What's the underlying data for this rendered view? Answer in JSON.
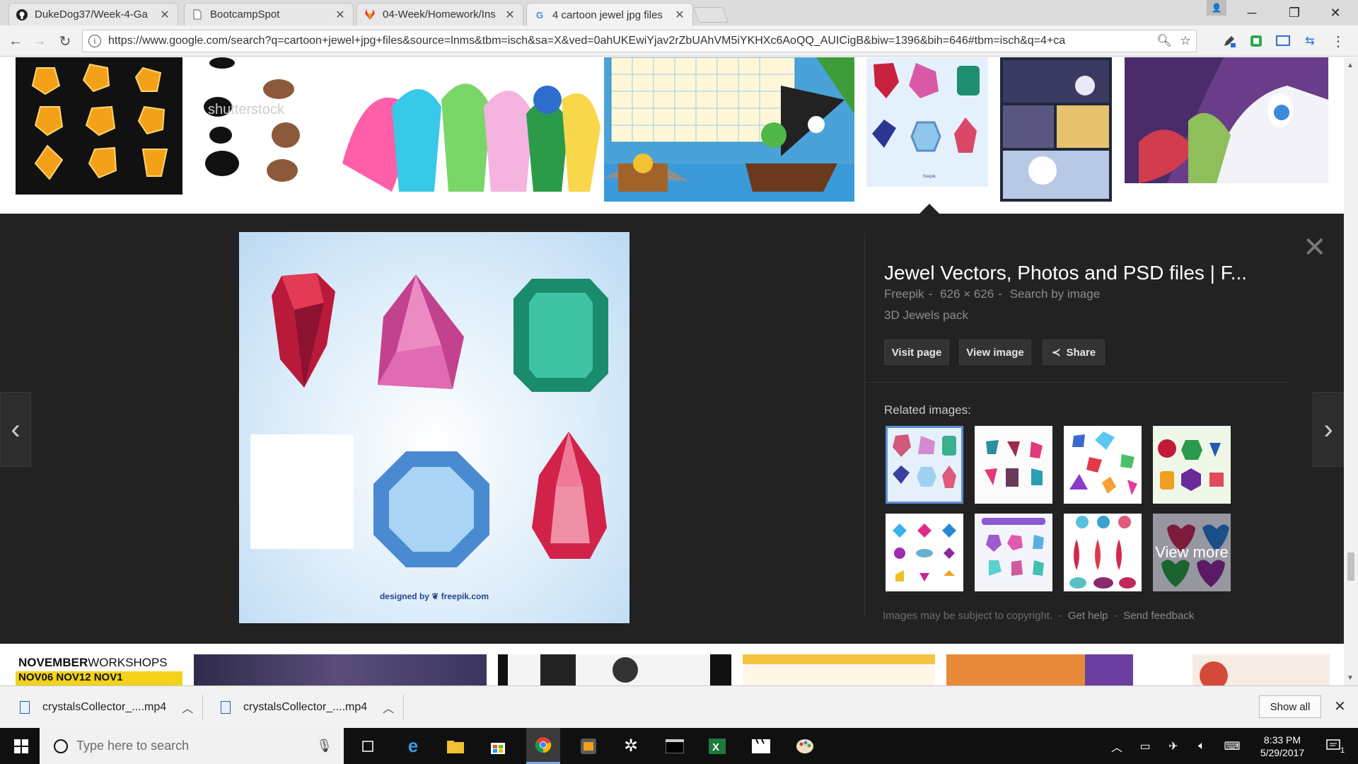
{
  "browser": {
    "tabs": [
      {
        "title": "DukeDog37/Week-4-Ga",
        "icon": "github-icon"
      },
      {
        "title": "BootcampSpot",
        "icon": "page-icon"
      },
      {
        "title": "04-Week/Homework/Ins",
        "icon": "gitlab-icon"
      },
      {
        "title": "4 cartoon jewel jpg files",
        "icon": "google-icon"
      }
    ],
    "active_tab": 3,
    "url": "https://www.google.com/search?q=cartoon+jewel+jpg+files&source=lnms&tbm=isch&sa=X&ved=0ahUKEwiYjav2rZbUAhVM5iYKHXc6AoQQ_AUICigB&biw=1396&bih=646#tbm=isch&q=4+ca"
  },
  "viewer": {
    "title": "Jewel Vectors, Photos and PSD files | F...",
    "source": "Freepik",
    "dimensions": "626 × 626",
    "search_by_image": "Search by image",
    "description": "3D Jewels pack",
    "visit_page": "Visit page",
    "view_image": "View image",
    "share": "Share",
    "related_label": "Related images:",
    "view_more": "View more",
    "copyright": "Images may be subject to copyright.",
    "get_help": "Get help",
    "send_feedback": "Send feedback",
    "image_credit": "designed by ❦ freepik.com"
  },
  "bottom_strip": {
    "banner_word1": "NOVEMBER",
    "banner_word2": "WORKSHOPS",
    "banner_dates": "NOV06 NOV12 NOV1"
  },
  "downloads": {
    "items": [
      {
        "name": "crystalsCollector_....mp4"
      },
      {
        "name": "crystalsCollector_....mp4"
      }
    ],
    "show_all": "Show all"
  },
  "taskbar": {
    "search_placeholder": "Type here to search",
    "time": "8:33 PM",
    "date": "5/29/2017",
    "notification_count": "1"
  },
  "colors": {
    "viewer_bg": "#222222",
    "selected_outline": "#5b8fd6"
  }
}
